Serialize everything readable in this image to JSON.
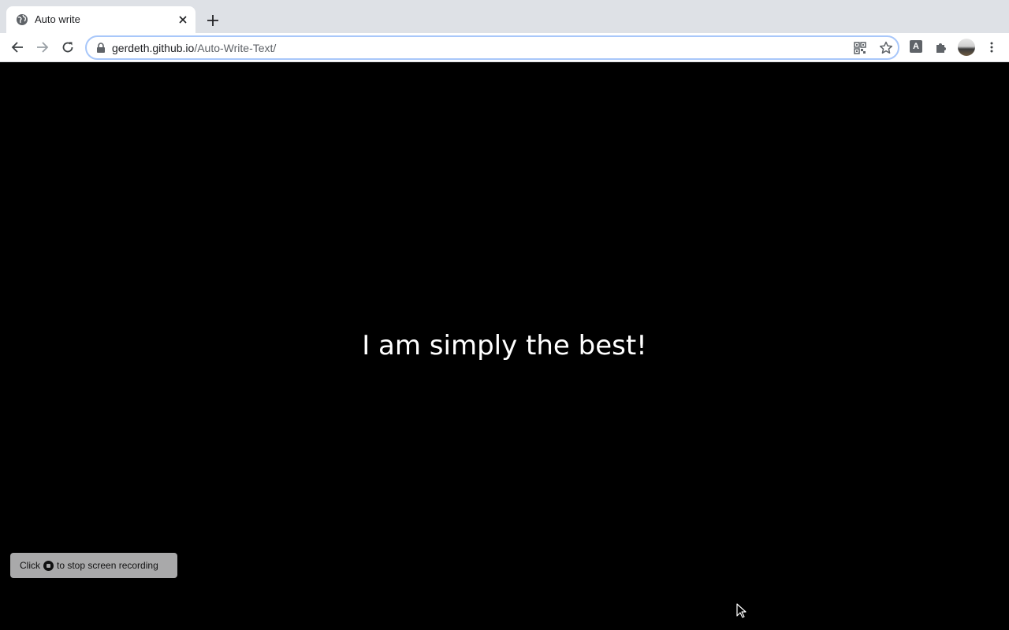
{
  "browser": {
    "tab": {
      "title": "Auto write",
      "favicon": "globe-icon",
      "close_icon": "close-icon"
    },
    "new_tab_icon": "plus-icon",
    "toolbar": {
      "back_icon": "arrow-left-icon",
      "forward_icon": "arrow-right-icon",
      "reload_icon": "reload-icon",
      "url_host": "gerdeth.github.io",
      "url_path": "/Auto-Write-Text/",
      "lock_icon": "lock-icon",
      "qr_icon": "qr-code-icon",
      "bookmark_icon": "star-icon",
      "extension_a_label": "A",
      "extensions_icon": "puzzle-icon",
      "menu_icon": "kebab-menu-icon"
    }
  },
  "page": {
    "headline": "I am simply the best!",
    "background": "#000000",
    "text_color": "#ffffff"
  },
  "recording_notice": {
    "before": "Click",
    "after": "to stop screen recording",
    "stop_icon": "stop-record-icon"
  }
}
